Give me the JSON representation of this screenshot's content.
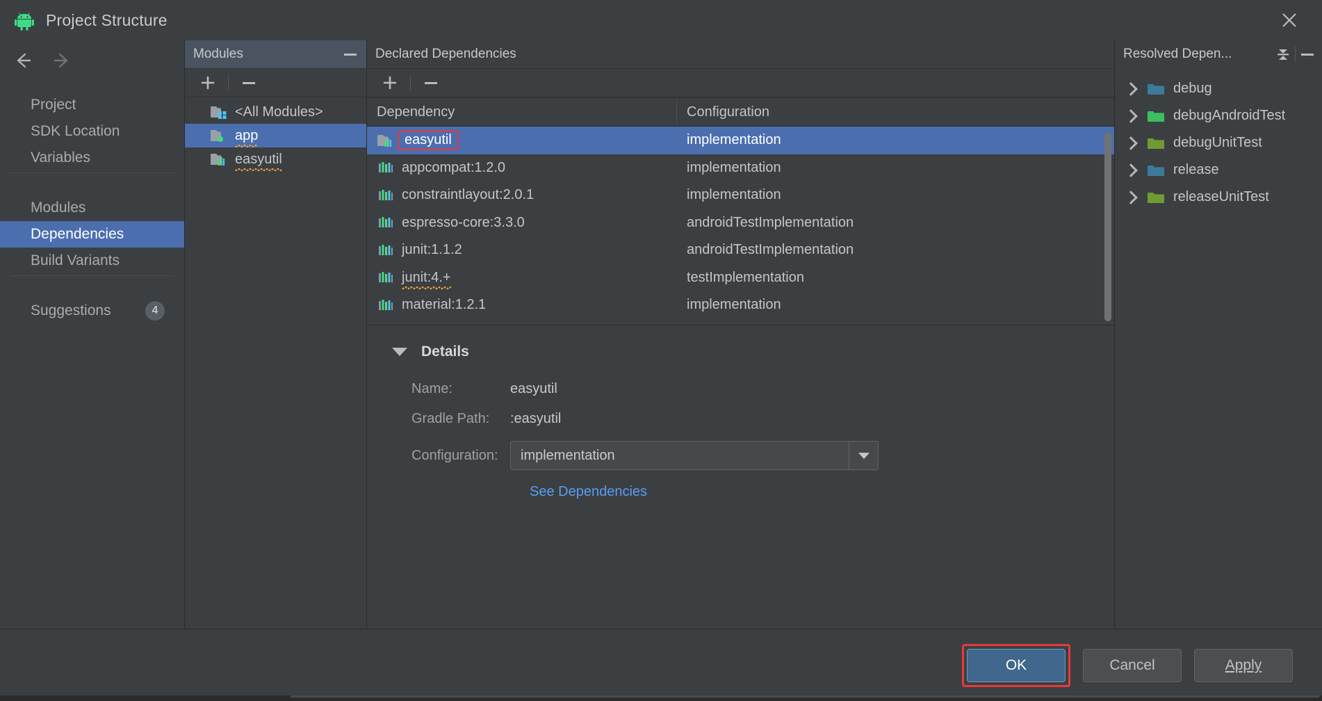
{
  "window": {
    "title": "Project Structure",
    "app_icon": "android-icon",
    "close_icon": "close-icon"
  },
  "nav": {
    "back_icon": "arrow-left-icon",
    "forward_icon": "arrow-right-icon"
  },
  "sidebar": {
    "items": [
      {
        "label": "Project",
        "selected": false
      },
      {
        "label": "SDK Location",
        "selected": false
      },
      {
        "label": "Variables",
        "selected": false
      },
      {
        "label": "Modules",
        "selected": false
      },
      {
        "label": "Dependencies",
        "selected": true
      },
      {
        "label": "Build Variants",
        "selected": false
      },
      {
        "label": "Suggestions",
        "selected": false,
        "badge": "4"
      }
    ]
  },
  "modules_panel": {
    "title": "Modules",
    "collapse_icon": "minus-icon",
    "toolbar": {
      "add_icon": "plus-icon",
      "remove_icon": "minus-icon"
    },
    "items": [
      {
        "label": "<All Modules>",
        "icon": "all-modules-folder-icon",
        "selected": false,
        "warning": false
      },
      {
        "label": "app",
        "icon": "app-module-folder-icon",
        "selected": true,
        "warning": true
      },
      {
        "label": "easyutil",
        "icon": "library-module-folder-icon",
        "selected": false,
        "warning": true
      }
    ]
  },
  "declared_panel": {
    "title": "Declared Dependencies",
    "toolbar": {
      "add_icon": "plus-icon",
      "remove_icon": "minus-icon"
    },
    "columns": [
      "Dependency",
      "Configuration"
    ],
    "rows": [
      {
        "name": "easyutil",
        "configuration": "implementation",
        "icon": "module-icon",
        "selected": true,
        "highlighted": true,
        "warning": false
      },
      {
        "name": "appcompat:1.2.0",
        "configuration": "implementation",
        "icon": "library-icon",
        "selected": false,
        "highlighted": false,
        "warning": false
      },
      {
        "name": "constraintlayout:2.0.1",
        "configuration": "implementation",
        "icon": "library-icon",
        "selected": false,
        "highlighted": false,
        "warning": false
      },
      {
        "name": "espresso-core:3.3.0",
        "configuration": "androidTestImplementation",
        "icon": "library-icon",
        "selected": false,
        "highlighted": false,
        "warning": false
      },
      {
        "name": "junit:1.1.2",
        "configuration": "androidTestImplementation",
        "icon": "library-icon",
        "selected": false,
        "highlighted": false,
        "warning": false
      },
      {
        "name": "junit:4.+",
        "configuration": "testImplementation",
        "icon": "library-icon",
        "selected": false,
        "highlighted": false,
        "warning": true
      },
      {
        "name": "material:1.2.1",
        "configuration": "implementation",
        "icon": "library-icon",
        "selected": false,
        "highlighted": false,
        "warning": false
      }
    ]
  },
  "details": {
    "title": "Details",
    "expanded": true,
    "name_label": "Name:",
    "name_value": "easyutil",
    "gradle_path_label": "Gradle Path:",
    "gradle_path_value": ":easyutil",
    "configuration_label": "Configuration:",
    "configuration_value": "implementation",
    "dropdown_icon": "chevron-down-icon",
    "see_dependencies_link": "See Dependencies"
  },
  "resolved_panel": {
    "title": "Resolved Depen...",
    "expand_collapse_icon": "expand-collapse-icon",
    "collapse_icon": "minus-icon",
    "items": [
      {
        "label": "debug",
        "color": "#3d7a99"
      },
      {
        "label": "debugAndroidTest",
        "color": "#3dbf60"
      },
      {
        "label": "debugUnitTest",
        "color": "#6f9b34"
      },
      {
        "label": "release",
        "color": "#3d7a99"
      },
      {
        "label": "releaseUnitTest",
        "color": "#6f9b34"
      }
    ]
  },
  "footer": {
    "ok_label": "OK",
    "cancel_label": "Cancel",
    "apply_label": "Apply",
    "ok_highlighted": true
  },
  "colors": {
    "accent_selection": "#4b6eaf",
    "highlight_box": "#e8393b",
    "link": "#589df6",
    "background": "#3c3f41",
    "warning_squiggle": "#e8a33d"
  }
}
